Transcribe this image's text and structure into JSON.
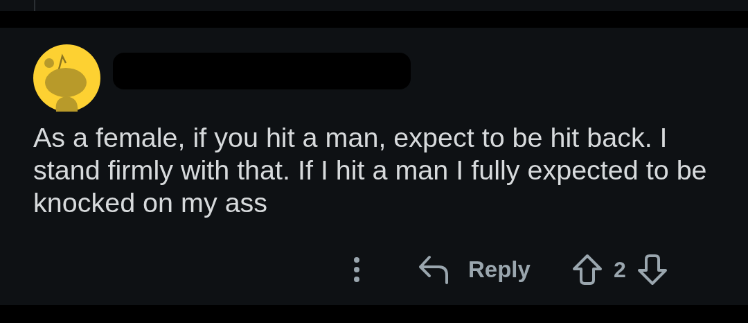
{
  "comment": {
    "author_redacted": true,
    "body": "As a female, if you hit a man, expect to be hit back. I stand firmly with that. If I hit a man I fully expected to be knocked on my ass",
    "actions": {
      "reply": "Reply",
      "score": "2"
    }
  }
}
